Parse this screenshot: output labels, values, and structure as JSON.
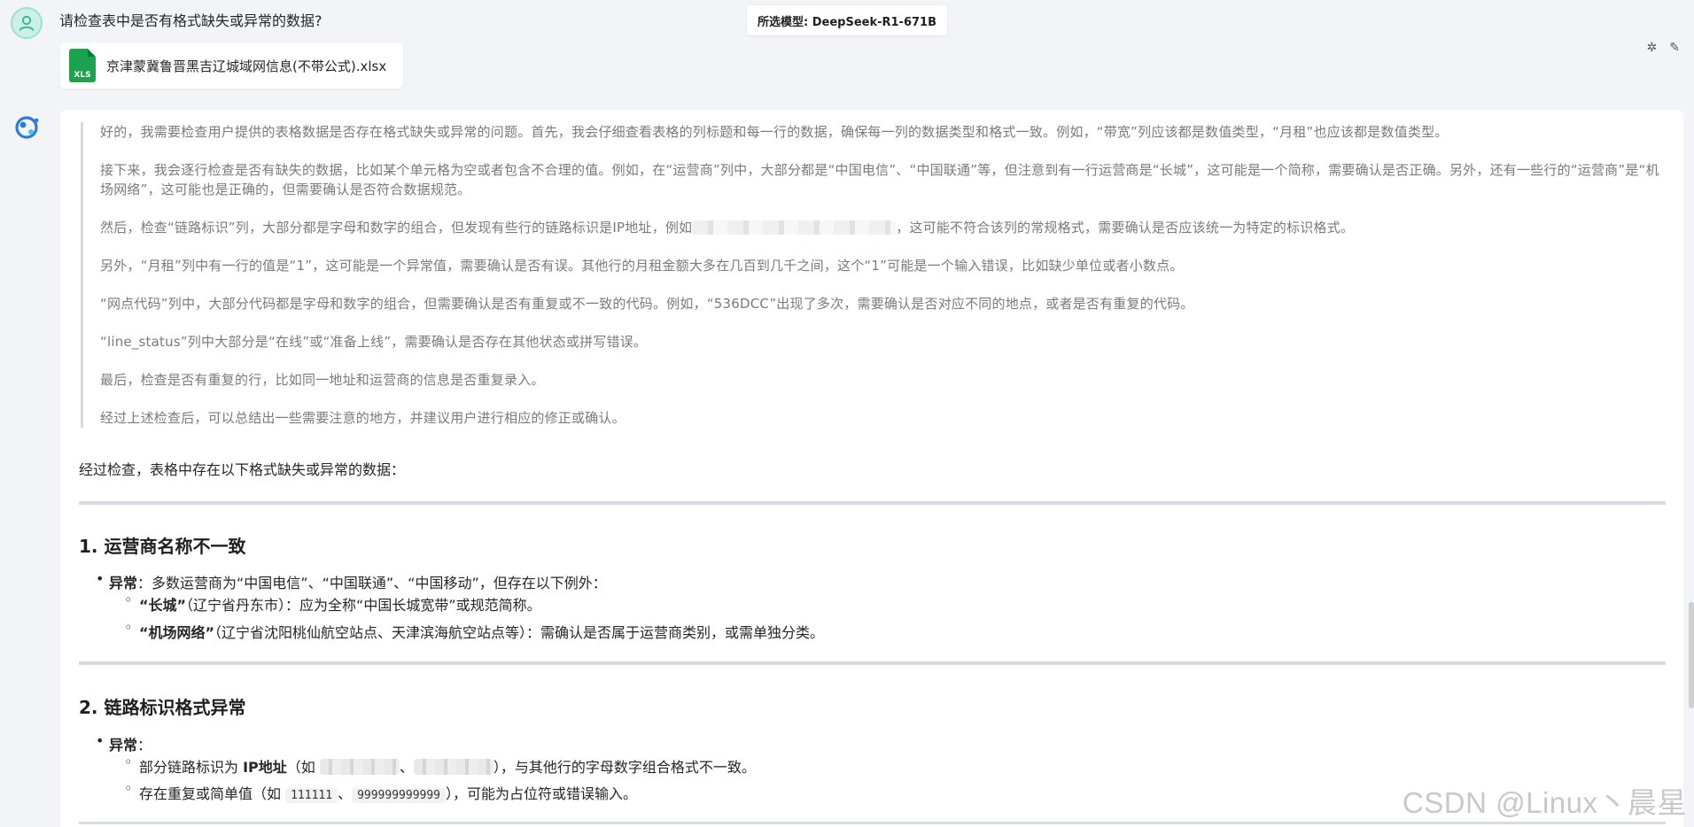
{
  "header": {
    "question": "请检查表中是否有格式缺失或异常的数据?",
    "model_label": "所选模型: DeepSeek-R1-671B"
  },
  "attachment": {
    "icon_label": "XLS",
    "file_name": "京津蒙冀鲁晋黑吉辽城域网信息(不带公式).xlsx",
    "icon": "xls-file-icon"
  },
  "top_actions": {
    "icons": [
      "sparkle-icon",
      "edit-icon"
    ]
  },
  "thinking": {
    "p1": "好的，我需要检查用户提供的表格数据是否存在格式缺失或异常的问题。首先，我会仔细查看表格的列标题和每一行的数据，确保每一列的数据类型和格式一致。例如，“带宽”列应该都是数值类型，“月租”也应该都是数值类型。",
    "p2": "接下来，我会逐行检查是否有缺失的数据，比如某个单元格为空或者包含不合理的值。例如，在“运营商”列中，大部分都是“中国电信”、“中国联通”等，但注意到有一行运营商是“长城”，这可能是一个简称，需要确认是否正确。另外，还有一些行的“运营商”是“机场网络”，这可能也是正确的，但需要确认是否符合数据规范。",
    "p3_before": "然后，检查“链路标识”列，大部分都是字母和数字的组合，但发现有些行的链路标识是IP地址，例如",
    "p3_after": "，这可能不符合该列的常规格式，需要确认是否应该统一为特定的标识格式。",
    "p4": "另外，“月租”列中有一行的值是“1”，这可能是一个异常值，需要确认是否有误。其他行的月租金额大多在几百到几千之间，这个“1”可能是一个输入错误，比如缺少单位或者小数点。",
    "p5": "“网点代码”列中，大部分代码都是字母和数字的组合，但需要确认是否有重复或不一致的代码。例如，“536DCC”出现了多次，需要确认是否对应不同的地点，或者是否有重复的代码。",
    "p6": "“line_status”列中大部分是“在线”或“准备上线”，需要确认是否存在其他状态或拼写错误。",
    "p7": "最后，检查是否有重复的行，比如同一地址和运营商的信息是否重复录入。",
    "p8": "经过上述检查后，可以总结出一些需要注意的地方，并建议用户进行相应的修正或确认。"
  },
  "answer": {
    "summary": "经过检查，表格中存在以下格式缺失或异常的数据：",
    "section1": {
      "title": "1. 运营商名称不一致",
      "bullet_label": "异常",
      "bullet_text": "：多数运营商为“中国电信”、“中国联通”、“中国移动”，但存在以下例外：",
      "sub1_bold": "“长城”",
      "sub1_text": "（辽宁省丹东市）：应为全称“中国长城宽带”或规范简称。",
      "sub2_bold": "“机场网络”",
      "sub2_text": "（辽宁省沈阳桃仙航空站点、天津滨海航空站点等）：需确认是否属于运营商类别，或需单独分类。"
    },
    "section2": {
      "title": "2. 链路标识格式异常",
      "bullet_label": "异常",
      "bullet_colon": "：",
      "sub1_prefix": "部分链路标识为 ",
      "sub1_bold": "IP地址",
      "sub1_mid": "（如 ",
      "sub1_sep": "、",
      "sub1_suffix": "），与其他行的字母数字组合格式不一致。",
      "sub2_prefix": "存在重复或简单值（如 ",
      "sub2_code1": "111111",
      "sub2_sep": "、",
      "sub2_code2": "999999999999",
      "sub2_suffix": "），可能为占位符或错误输入。"
    }
  },
  "watermark": "CSDN @Linux丶晨星"
}
